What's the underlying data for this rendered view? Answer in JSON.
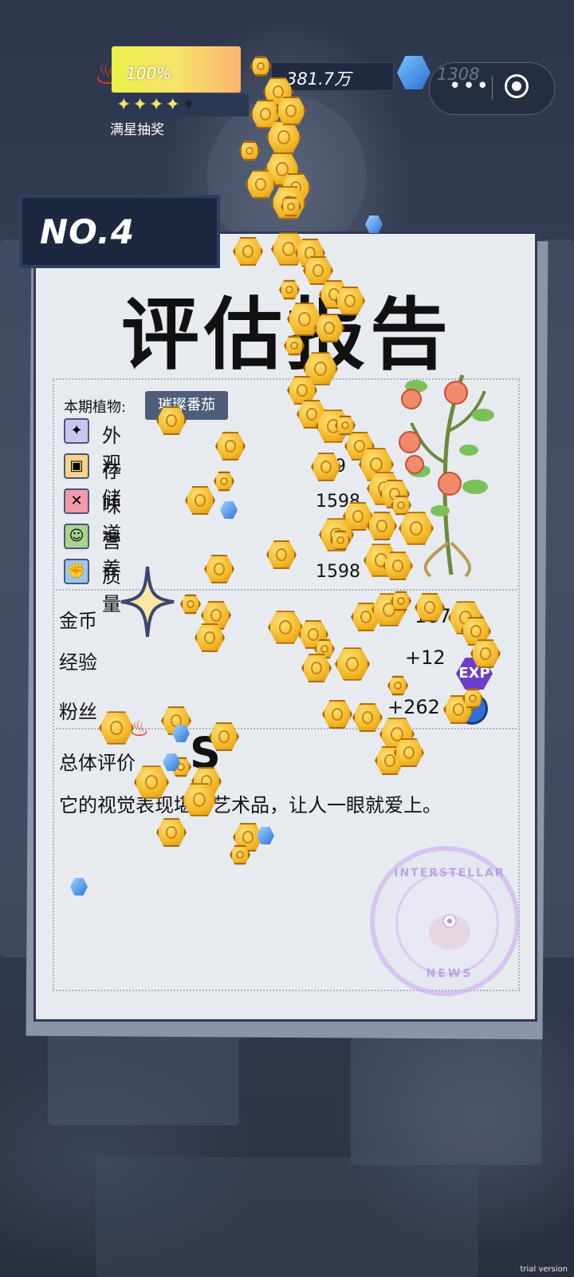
{
  "hud": {
    "heat_percent_label": "100%",
    "heat_fill": 1.0,
    "stars_filled": 4,
    "stars_total": 5,
    "lottery_label": "满星抽奖",
    "coins_label": "381.7万",
    "gems_label": "1308",
    "menu_icon": "more-dots-icon",
    "close_icon": "target-close-icon"
  },
  "report": {
    "badge": "NO.4",
    "title": "评估报告",
    "plant_label": "本期植物:",
    "plant_name": "璀璨番茄",
    "attributes": [
      {
        "label": "外观",
        "value": "",
        "icon": "sparkle-icon",
        "color": "#c7c7f0"
      },
      {
        "label": "存储",
        "value": "9",
        "icon": "box-icon",
        "color": "#f5d48a"
      },
      {
        "label": "味道",
        "value": "1598",
        "icon": "fork-knife-icon",
        "color": "#f19aa8"
      },
      {
        "label": "营养",
        "value": "1",
        "icon": "frog-icon",
        "color": "#a9d48e"
      },
      {
        "label": "质量",
        "value": "1598",
        "icon": "muscle-icon",
        "color": "#9cc6ee"
      }
    ],
    "rewards": [
      {
        "label": "金币",
        "value": "187"
      },
      {
        "label": "经验",
        "value": "+12"
      },
      {
        "label": "粉丝",
        "value": "+262"
      }
    ],
    "exp_badge": "EXP",
    "overall_label": "总体评价",
    "grade": "S",
    "comment": "它的视觉表现堪称艺术品，让人一眼就爱上。",
    "stamp_top": "INTERSTELLAR",
    "stamp_bottom": "NEWS"
  },
  "watermark": "trial version"
}
